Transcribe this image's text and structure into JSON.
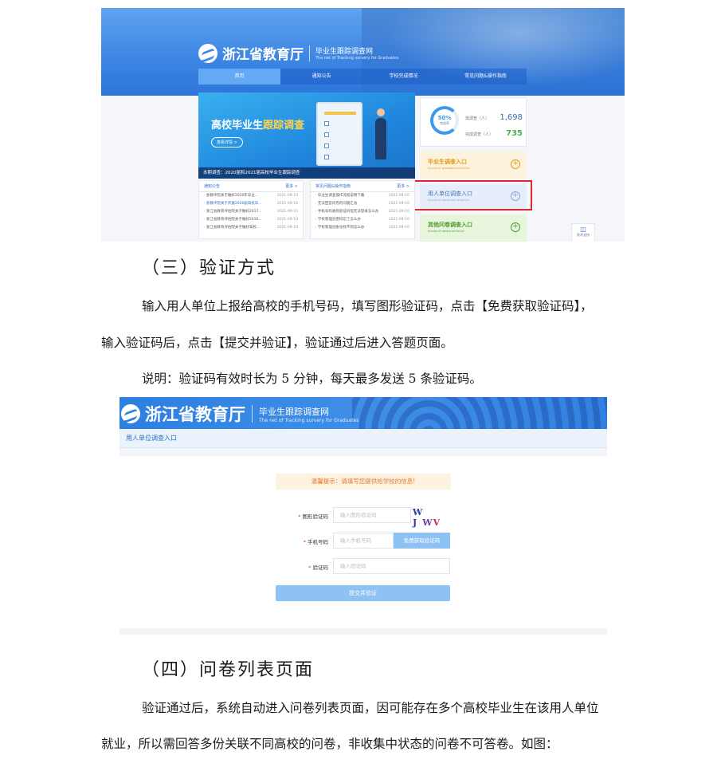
{
  "portal": {
    "brand": "浙江省教育厅",
    "site_name": "毕业生跟踪调查网",
    "site_name_en": "The net of Tracking survery for Graduates",
    "nav": [
      "首页",
      "通知公告",
      "学校完成情况",
      "常见问题&操作指南"
    ],
    "hero_title_prefix": "高校毕业生",
    "hero_title_highlight": "跟踪调查",
    "hero_button": "查看详情 >",
    "hero_caption": "本期调查：2020届和2021届高校毕业生跟踪调查",
    "stats": {
      "percent": "50%",
      "percent_label": "完成率",
      "row1_label": "需调查（人）",
      "row1_value": "1,698",
      "row2_label": "完成调查（人）",
      "row2_value": "735"
    },
    "entries": {
      "graduate_title": "毕业生调查入口",
      "graduate_en": "Survey of graduates entrance",
      "employer_title": "用人单位调查入口",
      "employer_en": "Survey of personnel entrance",
      "other_title": "其他问卷调查入口",
      "other_en": "Survey of others entrance",
      "plus": "+"
    },
    "notices": {
      "title": "通知公告",
      "more": "更多 >",
      "items": [
        {
          "text": "· 浙教评院关于做好2020年毕业...",
          "date": "2021-09-10"
        },
        {
          "text": "· 浙教评院关于开展2020届高校毕...",
          "date": "2021-09-16"
        },
        {
          "text": "· 浙江省教育评估院关于做好2017...",
          "date": "2021-09-10"
        },
        {
          "text": "· 浙江省教育评估院关于做好2016...",
          "date": "2021-09-10"
        },
        {
          "text": "· 浙江省教育评估院关于做好高校...",
          "date": "2021-09-10"
        }
      ]
    },
    "faq": {
      "title": "常见问题&操作指南",
      "more": "更多 >",
      "items": [
        {
          "text": "· 毕业生调查操作流程说明下载",
          "date": "2021-09-10"
        },
        {
          "text": "· 无法回答问卷的问题汇总",
          "date": "2021-09-10"
        },
        {
          "text": "· 手机号码收到验证码但无法登录怎么办",
          "date": "2021-09-10"
        },
        {
          "text": "· 学校管理员密码忘了怎么办",
          "date": "2021-09-10"
        },
        {
          "text": "· 学校管理员账号找不到怎么办",
          "date": "2021-09-10"
        }
      ]
    },
    "support": "技术支持"
  },
  "doc": {
    "heading3": "（三）验证方式",
    "para1_line1": "输入用人单位上报给高校的手机号码，填写图形验证码，点击【免费获取验证码】，",
    "para1_line2": "输入验证码后，点击【提交并验证】，验证通过后进入答题页面。",
    "note": "说明：验证码有效时长为 5 分钟，每天最多发送 5 条验证码。",
    "heading4": "（四）问卷列表页面",
    "para2_line1": "验证通过后，系统自动进入问卷列表页面，因可能存在多个高校毕业生在该用人单位",
    "para2_line2": "就业，所以需回答多份关联不同高校的问卷，非收集中状态的问卷不可答卷。如图："
  },
  "verify": {
    "brand": "浙江省教育厅",
    "site_name": "毕业生跟踪调查网",
    "site_name_en": "The net of Tracking survery for Graduates",
    "breadcrumb": "用人单位调查入口",
    "tip": "温馨提示：请填写您提供给学校的信息!",
    "required_mark": "*",
    "captcha_label": "图形验证码",
    "captcha_placeholder": "输入图形验证码",
    "captcha_text_1": "W J",
    "captcha_text_2": "W",
    "captcha_text_3": "V",
    "phone_label": "手机号码",
    "phone_placeholder": "输入手机号码",
    "send_code_button": "免费获取验证码",
    "code_label": "验证码",
    "code_placeholder": "输入验证码",
    "submit_button": "提交并验证"
  }
}
